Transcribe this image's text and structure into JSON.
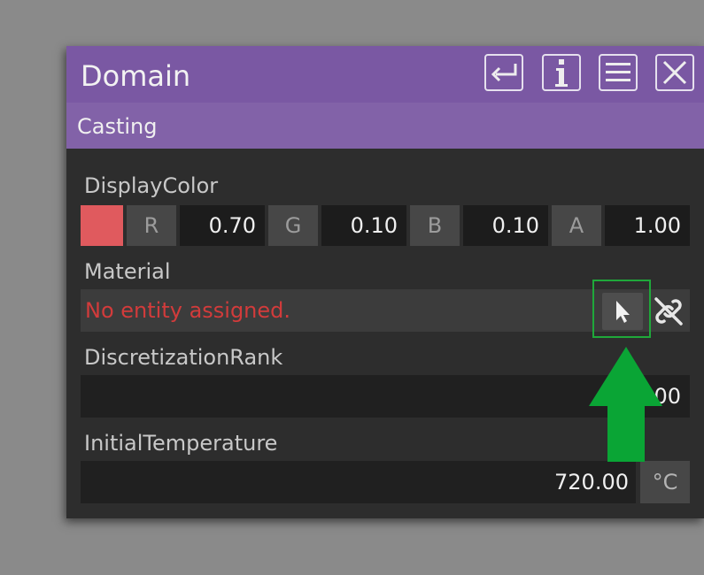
{
  "window": {
    "title": "Domain",
    "section": "Casting",
    "buttons": [
      "return-icon",
      "info-icon",
      "menu-icon",
      "close-icon"
    ]
  },
  "display_color": {
    "label": "DisplayColor",
    "swatch": "#e05a5e",
    "channels": [
      {
        "name": "R",
        "value": "0.70"
      },
      {
        "name": "G",
        "value": "0.10"
      },
      {
        "name": "B",
        "value": "0.10"
      },
      {
        "name": "A",
        "value": "1.00"
      }
    ]
  },
  "material": {
    "label": "Material",
    "status": "No entity assigned.",
    "status_color": "#d23b3b"
  },
  "discretization": {
    "label": "DiscretizationRank",
    "value": "00"
  },
  "initial_temperature": {
    "label": "InitialTemperature",
    "value": "720.00",
    "unit": "°C"
  },
  "colors": {
    "titlebar": "#7a58a3",
    "panel": "#2d2d2d",
    "highlight_box": "#1fa83a",
    "arrow": "#0aa535"
  }
}
